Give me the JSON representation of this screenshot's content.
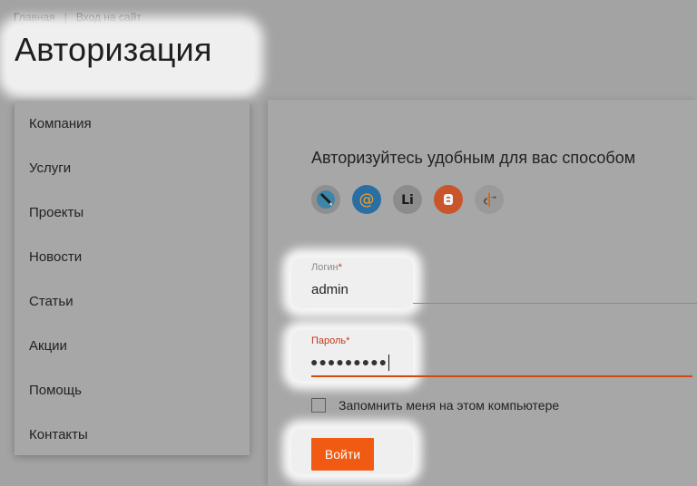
{
  "breadcrumb": {
    "home": "Главная",
    "separator": "|",
    "current": "Вход на сайт"
  },
  "page": {
    "title": "Авторизация"
  },
  "sidebar": {
    "items": [
      {
        "label": "Компания"
      },
      {
        "label": "Услуги"
      },
      {
        "label": "Проекты"
      },
      {
        "label": "Новости"
      },
      {
        "label": "Статьи"
      },
      {
        "label": "Акции"
      },
      {
        "label": "Помощь"
      },
      {
        "label": "Контакты"
      }
    ]
  },
  "auth": {
    "heading": "Авторизуйтесь удобным для вас способом",
    "social": [
      {
        "icon": "livejournal-icon"
      },
      {
        "icon": "mailru-icon"
      },
      {
        "icon": "liveinternet-icon"
      },
      {
        "icon": "blogger-icon"
      },
      {
        "icon": "openid-icon"
      }
    ],
    "login": {
      "label": "Логин",
      "required_mark": "*",
      "value": "admin"
    },
    "password": {
      "label": "Пароль",
      "required_mark": "*",
      "value": "●●●●●●●●●"
    },
    "remember_label": "Запомнить меня на этом компьютере",
    "submit_label": "Войти"
  },
  "colors": {
    "accent": "#f05a12",
    "required": "#c0391b",
    "overlay_bg": "#a3a3a3",
    "highlight": "#efefef"
  }
}
